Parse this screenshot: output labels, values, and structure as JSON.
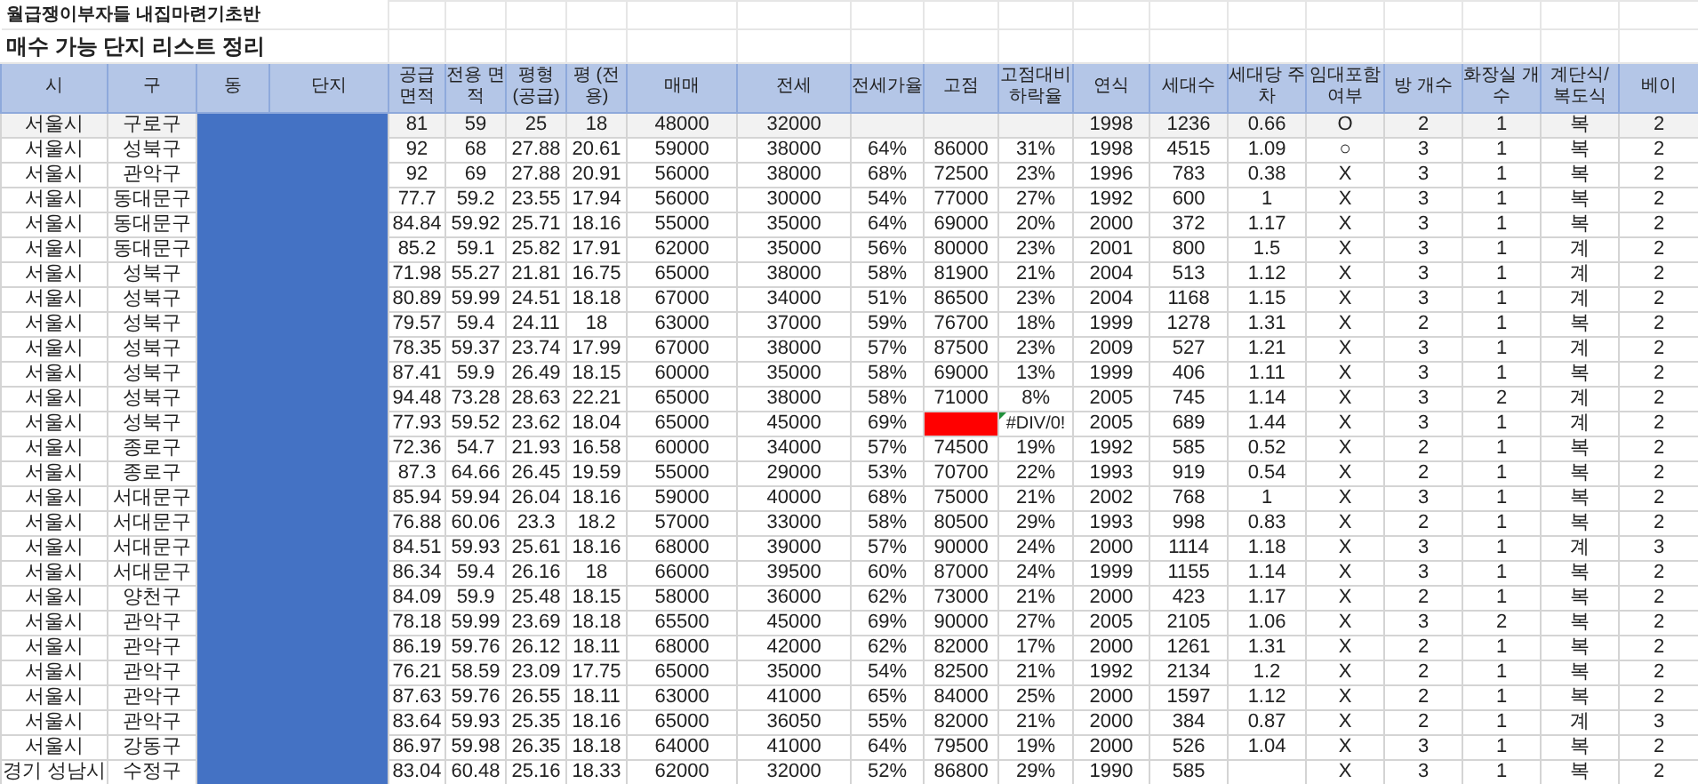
{
  "titles": [
    "월급쟁이부자들 내집마련기초반",
    "매수 가능 단지 리스트 정리"
  ],
  "table": {
    "columns": [
      "시",
      "구",
      "동",
      "단지",
      "공급 면적",
      "전용 면적",
      "평형 (공급)",
      "평 (전용)",
      "매매",
      "전세",
      "전세가율",
      "고점",
      "고점대비 하락율",
      "연식",
      "세대수",
      "세대당 주차",
      "임대포함 여부",
      "방 개수",
      "화장실 개수",
      "계단식/ 복도식",
      "베이"
    ],
    "rows": [
      {
        "selected": true,
        "peak_error": false,
        "formula_warning": false,
        "cells": [
          "서울시",
          "구로구",
          null,
          null,
          "81",
          "59",
          "25",
          "18",
          "48000",
          "32000",
          null,
          null,
          null,
          "1998",
          "1236",
          "0.66",
          "O",
          "2",
          "1",
          "복",
          "2"
        ]
      },
      {
        "selected": false,
        "peak_error": false,
        "formula_warning": false,
        "cells": [
          "서울시",
          "성북구",
          null,
          null,
          "92",
          "68",
          "27.88",
          "20.61",
          "59000",
          "38000",
          "64%",
          "86000",
          "31%",
          "1998",
          "4515",
          "1.09",
          "○",
          "3",
          "1",
          "복",
          "2"
        ]
      },
      {
        "selected": false,
        "peak_error": false,
        "formula_warning": false,
        "cells": [
          "서울시",
          "관악구",
          null,
          null,
          "92",
          "69",
          "27.88",
          "20.91",
          "56000",
          "38000",
          "68%",
          "72500",
          "23%",
          "1996",
          "783",
          "0.38",
          "X",
          "3",
          "1",
          "복",
          "2"
        ]
      },
      {
        "selected": false,
        "peak_error": false,
        "formula_warning": false,
        "cells": [
          "서울시",
          "동대문구",
          null,
          null,
          "77.7",
          "59.2",
          "23.55",
          "17.94",
          "56000",
          "30000",
          "54%",
          "77000",
          "27%",
          "1992",
          "600",
          "1",
          "X",
          "3",
          "1",
          "복",
          "2"
        ]
      },
      {
        "selected": false,
        "peak_error": false,
        "formula_warning": false,
        "cells": [
          "서울시",
          "동대문구",
          null,
          null,
          "84.84",
          "59.92",
          "25.71",
          "18.16",
          "55000",
          "35000",
          "64%",
          "69000",
          "20%",
          "2000",
          "372",
          "1.17",
          "X",
          "3",
          "1",
          "복",
          "2"
        ]
      },
      {
        "selected": false,
        "peak_error": false,
        "formula_warning": false,
        "cells": [
          "서울시",
          "동대문구",
          null,
          null,
          "85.2",
          "59.1",
          "25.82",
          "17.91",
          "62000",
          "35000",
          "56%",
          "80000",
          "23%",
          "2001",
          "800",
          "1.5",
          "X",
          "3",
          "1",
          "계",
          "2"
        ]
      },
      {
        "selected": false,
        "peak_error": false,
        "formula_warning": false,
        "cells": [
          "서울시",
          "성북구",
          null,
          null,
          "71.98",
          "55.27",
          "21.81",
          "16.75",
          "65000",
          "38000",
          "58%",
          "81900",
          "21%",
          "2004",
          "513",
          "1.12",
          "X",
          "3",
          "1",
          "계",
          "2"
        ]
      },
      {
        "selected": false,
        "peak_error": false,
        "formula_warning": false,
        "cells": [
          "서울시",
          "성북구",
          null,
          null,
          "80.89",
          "59.99",
          "24.51",
          "18.18",
          "67000",
          "34000",
          "51%",
          "86500",
          "23%",
          "2004",
          "1168",
          "1.15",
          "X",
          "3",
          "1",
          "계",
          "2"
        ]
      },
      {
        "selected": false,
        "peak_error": false,
        "formula_warning": false,
        "cells": [
          "서울시",
          "성북구",
          null,
          null,
          "79.57",
          "59.4",
          "24.11",
          "18",
          "63000",
          "37000",
          "59%",
          "76700",
          "18%",
          "1999",
          "1278",
          "1.31",
          "X",
          "2",
          "1",
          "복",
          "2"
        ]
      },
      {
        "selected": false,
        "peak_error": false,
        "formula_warning": false,
        "cells": [
          "서울시",
          "성북구",
          null,
          null,
          "78.35",
          "59.37",
          "23.74",
          "17.99",
          "67000",
          "38000",
          "57%",
          "87500",
          "23%",
          "2009",
          "527",
          "1.21",
          "X",
          "3",
          "1",
          "계",
          "2"
        ]
      },
      {
        "selected": false,
        "peak_error": false,
        "formula_warning": false,
        "cells": [
          "서울시",
          "성북구",
          null,
          null,
          "87.41",
          "59.9",
          "26.49",
          "18.15",
          "60000",
          "35000",
          "58%",
          "69000",
          "13%",
          "1999",
          "406",
          "1.11",
          "X",
          "3",
          "1",
          "복",
          "2"
        ]
      },
      {
        "selected": false,
        "peak_error": false,
        "formula_warning": false,
        "cells": [
          "서울시",
          "성북구",
          null,
          null,
          "94.48",
          "73.28",
          "28.63",
          "22.21",
          "65000",
          "38000",
          "58%",
          "71000",
          "8%",
          "2005",
          "745",
          "1.14",
          "X",
          "3",
          "2",
          "계",
          "2"
        ]
      },
      {
        "selected": false,
        "peak_error": true,
        "formula_warning": true,
        "cells": [
          "서울시",
          "성북구",
          null,
          null,
          "77.93",
          "59.52",
          "23.62",
          "18.04",
          "65000",
          "45000",
          "69%",
          null,
          "#DIV/0!",
          "2005",
          "689",
          "1.44",
          "X",
          "3",
          "1",
          "계",
          "2"
        ]
      },
      {
        "selected": false,
        "peak_error": false,
        "formula_warning": false,
        "cells": [
          "서울시",
          "종로구",
          null,
          null,
          "72.36",
          "54.7",
          "21.93",
          "16.58",
          "60000",
          "34000",
          "57%",
          "74500",
          "19%",
          "1992",
          "585",
          "0.52",
          "X",
          "2",
          "1",
          "복",
          "2"
        ]
      },
      {
        "selected": false,
        "peak_error": false,
        "formula_warning": false,
        "cells": [
          "서울시",
          "종로구",
          null,
          null,
          "87.3",
          "64.66",
          "26.45",
          "19.59",
          "55000",
          "29000",
          "53%",
          "70700",
          "22%",
          "1993",
          "919",
          "0.54",
          "X",
          "2",
          "1",
          "복",
          "2"
        ]
      },
      {
        "selected": false,
        "peak_error": false,
        "formula_warning": false,
        "cells": [
          "서울시",
          "서대문구",
          null,
          null,
          "85.94",
          "59.94",
          "26.04",
          "18.16",
          "59000",
          "40000",
          "68%",
          "75000",
          "21%",
          "2002",
          "768",
          "1",
          "X",
          "3",
          "1",
          "복",
          "2"
        ]
      },
      {
        "selected": false,
        "peak_error": false,
        "formula_warning": false,
        "cells": [
          "서울시",
          "서대문구",
          null,
          null,
          "76.88",
          "60.06",
          "23.3",
          "18.2",
          "57000",
          "33000",
          "58%",
          "80500",
          "29%",
          "1993",
          "998",
          "0.83",
          "X",
          "2",
          "1",
          "복",
          "2"
        ]
      },
      {
        "selected": false,
        "peak_error": false,
        "formula_warning": false,
        "cells": [
          "서울시",
          "서대문구",
          null,
          null,
          "84.51",
          "59.93",
          "25.61",
          "18.16",
          "68000",
          "39000",
          "57%",
          "90000",
          "24%",
          "2000",
          "1114",
          "1.18",
          "X",
          "3",
          "1",
          "계",
          "3"
        ]
      },
      {
        "selected": false,
        "peak_error": false,
        "formula_warning": false,
        "cells": [
          "서울시",
          "서대문구",
          null,
          null,
          "86.34",
          "59.4",
          "26.16",
          "18",
          "66000",
          "39500",
          "60%",
          "87000",
          "24%",
          "1999",
          "1155",
          "1.14",
          "X",
          "3",
          "1",
          "복",
          "2"
        ]
      },
      {
        "selected": false,
        "peak_error": false,
        "formula_warning": false,
        "cells": [
          "서울시",
          "양천구",
          null,
          null,
          "84.09",
          "59.9",
          "25.48",
          "18.15",
          "58000",
          "36000",
          "62%",
          "73000",
          "21%",
          "2000",
          "423",
          "1.17",
          "X",
          "2",
          "1",
          "복",
          "2"
        ]
      },
      {
        "selected": false,
        "peak_error": false,
        "formula_warning": false,
        "cells": [
          "서울시",
          "관악구",
          null,
          null,
          "78.18",
          "59.99",
          "23.69",
          "18.18",
          "65500",
          "45000",
          "69%",
          "90000",
          "27%",
          "2005",
          "2105",
          "1.06",
          "X",
          "3",
          "2",
          "복",
          "2"
        ]
      },
      {
        "selected": false,
        "peak_error": false,
        "formula_warning": false,
        "cells": [
          "서울시",
          "관악구",
          null,
          null,
          "86.19",
          "59.76",
          "26.12",
          "18.11",
          "68000",
          "42000",
          "62%",
          "82000",
          "17%",
          "2000",
          "1261",
          "1.31",
          "X",
          "2",
          "1",
          "복",
          "2"
        ]
      },
      {
        "selected": false,
        "peak_error": false,
        "formula_warning": false,
        "cells": [
          "서울시",
          "관악구",
          null,
          null,
          "76.21",
          "58.59",
          "23.09",
          "17.75",
          "65000",
          "35000",
          "54%",
          "82500",
          "21%",
          "1992",
          "2134",
          "1.2",
          "X",
          "2",
          "1",
          "복",
          "2"
        ]
      },
      {
        "selected": false,
        "peak_error": false,
        "formula_warning": false,
        "cells": [
          "서울시",
          "관악구",
          null,
          null,
          "87.63",
          "59.76",
          "26.55",
          "18.11",
          "63000",
          "41000",
          "65%",
          "84000",
          "25%",
          "2000",
          "1597",
          "1.12",
          "X",
          "2",
          "1",
          "복",
          "2"
        ]
      },
      {
        "selected": false,
        "peak_error": false,
        "formula_warning": false,
        "cells": [
          "서울시",
          "관악구",
          null,
          null,
          "83.64",
          "59.93",
          "25.35",
          "18.16",
          "65000",
          "36050",
          "55%",
          "82000",
          "21%",
          "2000",
          "384",
          "0.87",
          "X",
          "2",
          "1",
          "계",
          "3"
        ]
      },
      {
        "selected": false,
        "peak_error": false,
        "formula_warning": false,
        "cells": [
          "서울시",
          "강동구",
          null,
          null,
          "86.97",
          "59.98",
          "26.35",
          "18.18",
          "64000",
          "41000",
          "64%",
          "79500",
          "19%",
          "2000",
          "526",
          "1.04",
          "X",
          "3",
          "1",
          "복",
          "2"
        ]
      },
      {
        "selected": false,
        "peak_error": false,
        "formula_warning": false,
        "cells": [
          "경기 성남시",
          "수정구",
          null,
          null,
          "83.04",
          "60.48",
          "25.16",
          "18.33",
          "62000",
          "32000",
          "52%",
          "86800",
          "29%",
          "1990",
          "585",
          null,
          "X",
          "3",
          "1",
          "복",
          "2"
        ]
      }
    ]
  }
}
